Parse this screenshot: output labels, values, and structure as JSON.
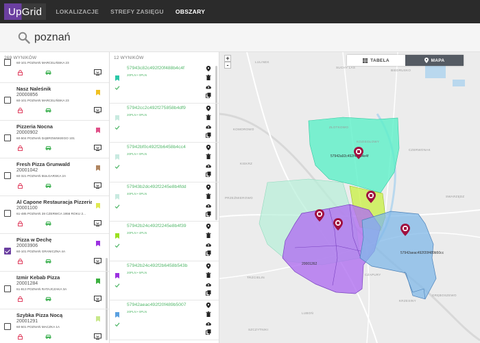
{
  "app": {
    "logo": "UpGrid"
  },
  "nav": {
    "items": [
      {
        "label": "LOKALIZACJE",
        "active": false
      },
      {
        "label": "STREFY ZASIĘGU",
        "active": false
      },
      {
        "label": "OBSZARY",
        "active": true
      }
    ]
  },
  "search": {
    "value": "poznań"
  },
  "locations": {
    "count_label": "269 WYNIKÓW",
    "items": [
      {
        "name": "",
        "id": "",
        "address": "60-101 POZNAŃ MARCELIŃSKA 23",
        "flag_color": "",
        "checked": false
      },
      {
        "name": "Nasz Naleśnik",
        "id": "20000856",
        "address": "60-101 POZNAŃ MARCELIŃSKA 23",
        "flag_color": "#f0c020",
        "checked": false
      },
      {
        "name": "Pizzeria Nocna",
        "id": "20000902",
        "address": "60-504 POZNAŃ DĄBROWSKIEGO 101",
        "flag_color": "#e05088",
        "checked": false
      },
      {
        "name": "Fresh Pizza Grunwald",
        "id": "20001042",
        "address": "60-321 POZNAŃ BUŁGARSKA 2A",
        "flag_color": "#b08560",
        "checked": false
      },
      {
        "name": "Al Capone Restauracja Pizzeria",
        "id": "20001100",
        "address": "61-485 POZNAŃ 28 CZERWCA 1956 ROKU 2...",
        "flag_color": "#e0e850",
        "checked": false
      },
      {
        "name": "Pizza w Dechę",
        "id": "20003906",
        "address": "60-101 POZNAŃ GRANICZNA 4A",
        "flag_color": "#9b30e0",
        "checked": true
      },
      {
        "name": "Izmir Kebab Pizza",
        "id": "20001284",
        "address": "61-813 POZNAŃ RATAJCZAKA 3A",
        "flag_color": "#3cb040",
        "checked": false
      },
      {
        "name": "Szybka Pizza Nocą",
        "id": "20001291",
        "address": "60-501 POZNAŃ MACZKA 1A",
        "flag_color": "#c8e88a",
        "checked": false
      }
    ]
  },
  "zones": {
    "count_label": "12 WYNIKÓW",
    "items": [
      {
        "id": "57943c82c492f20f488b4c4f",
        "price": "20PLN • 0PLN",
        "flag_color": "#2cc8a8"
      },
      {
        "id": "57942cc2c492f275858b4df9",
        "price": "20PLN • 0PLN",
        "flag_color": "#c8eae0"
      },
      {
        "id": "57942bf0c492f2b6458b4cc4",
        "price": "20PLN • 0PLN",
        "flag_color": "#c8eae0"
      },
      {
        "id": "57943b2dc492f2245e8b4fdd",
        "price": "40PLN • 0PLN",
        "flag_color": "#c8eae0"
      },
      {
        "id": "57942b24c492f2245e8b4f39",
        "price": "20PLN • 4PLN",
        "flag_color": "#9ae020"
      },
      {
        "id": "57942b24c492f2b6458b543b",
        "price": "20PLN • 5PLN",
        "flag_color": "#9b30e0"
      },
      {
        "id": "57942aeac492f20f489b5007",
        "price": "20PLN • 0PLN",
        "flag_color": "#5aa0e0"
      }
    ]
  },
  "map": {
    "toggle_table": "TABELA",
    "toggle_map": "MAPA",
    "zoom_in": "+",
    "zoom_out": "-",
    "place_labels": [
      {
        "text": "SUCHY LAS"
      },
      {
        "text": "BIEDRUSKO"
      },
      {
        "text": "LULINEK"
      },
      {
        "text": "ZŁOTKOWO"
      },
      {
        "text": "KOMOROWO"
      },
      {
        "text": "KOZIEGŁOWY"
      },
      {
        "text": "CZERWONAK"
      },
      {
        "text": "SWARZĘDZ"
      },
      {
        "text": "PRZEŹMIEROWO"
      },
      {
        "text": "LUBOŃ"
      },
      {
        "text": "CZAPURY"
      },
      {
        "text": "KRZESINY"
      },
      {
        "text": "TRZCIELIN"
      },
      {
        "text": "GRĘBOSZEWO"
      },
      {
        "text": "KIEKRZ"
      },
      {
        "text": "SZCZYTNIKI"
      }
    ],
    "zone_labels": [
      {
        "text": "57942a92c492f458b4e4f"
      },
      {
        "text": "57942aeac492f20f489b50cc"
      },
      {
        "text": "20001262"
      }
    ]
  },
  "colors": {
    "accent": "#6b3fa0",
    "green": "#53b86b",
    "pin": "#a01040"
  },
  "icons": [
    "search-icon",
    "lock-icon",
    "car-icon",
    "monitor-icon",
    "flag-icon",
    "check-icon",
    "map-pin-icon",
    "trash-icon",
    "upload-icon",
    "copy-icon",
    "grid-icon",
    "location-icon"
  ]
}
